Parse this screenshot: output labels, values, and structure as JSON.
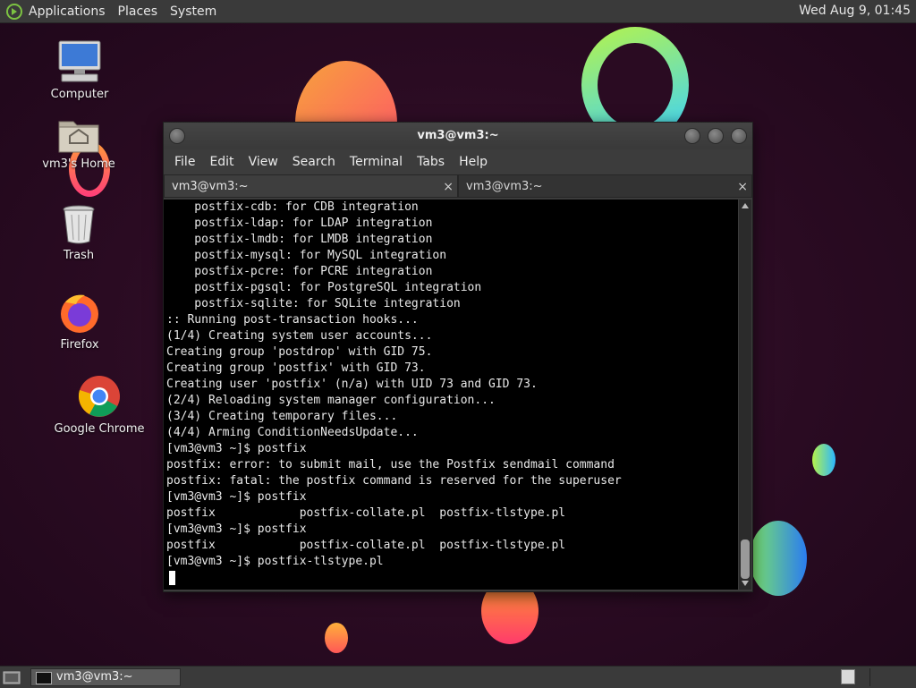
{
  "top_panel": {
    "menus": [
      "Applications",
      "Places",
      "System"
    ],
    "clock": "Wed Aug  9, 01:45"
  },
  "desktop_icons": {
    "computer": "Computer",
    "home": "vm3's Home",
    "trash": "Trash",
    "firefox": "Firefox",
    "chrome": "Google Chrome"
  },
  "window": {
    "title": "vm3@vm3:~",
    "menu": [
      "File",
      "Edit",
      "View",
      "Search",
      "Terminal",
      "Tabs",
      "Help"
    ],
    "tabs": [
      {
        "label": "vm3@vm3:~",
        "close": "×"
      },
      {
        "label": "vm3@vm3:~",
        "close": "×"
      }
    ]
  },
  "terminal": {
    "lines": [
      "    postfix-cdb: for CDB integration",
      "    postfix-ldap: for LDAP integration",
      "    postfix-lmdb: for LMDB integration",
      "    postfix-mysql: for MySQL integration",
      "    postfix-pcre: for PCRE integration",
      "    postfix-pgsql: for PostgreSQL integration",
      "    postfix-sqlite: for SQLite integration",
      ":: Running post-transaction hooks...",
      "(1/4) Creating system user accounts...",
      "Creating group 'postdrop' with GID 75.",
      "Creating group 'postfix' with GID 73.",
      "Creating user 'postfix' (n/a) with UID 73 and GID 73.",
      "(2/4) Reloading system manager configuration...",
      "(3/4) Creating temporary files...",
      "(4/4) Arming ConditionNeedsUpdate...",
      "[vm3@vm3 ~]$ postfix",
      "postfix: error: to submit mail, use the Postfix sendmail command",
      "postfix: fatal: the postfix command is reserved for the superuser",
      "[vm3@vm3 ~]$ postfix",
      "postfix            postfix-collate.pl  postfix-tlstype.pl",
      "[vm3@vm3 ~]$ postfix",
      "postfix            postfix-collate.pl  postfix-tlstype.pl",
      "[vm3@vm3 ~]$ postfix-tlstype.pl"
    ]
  },
  "bottom_panel": {
    "task_label": "vm3@vm3:~"
  },
  "colors": {
    "terminal_bg": "#000000",
    "terminal_fg": "#e8e8e8",
    "panel_bg": "#3a3a3a",
    "desktop_bg": "#2a0b22"
  }
}
